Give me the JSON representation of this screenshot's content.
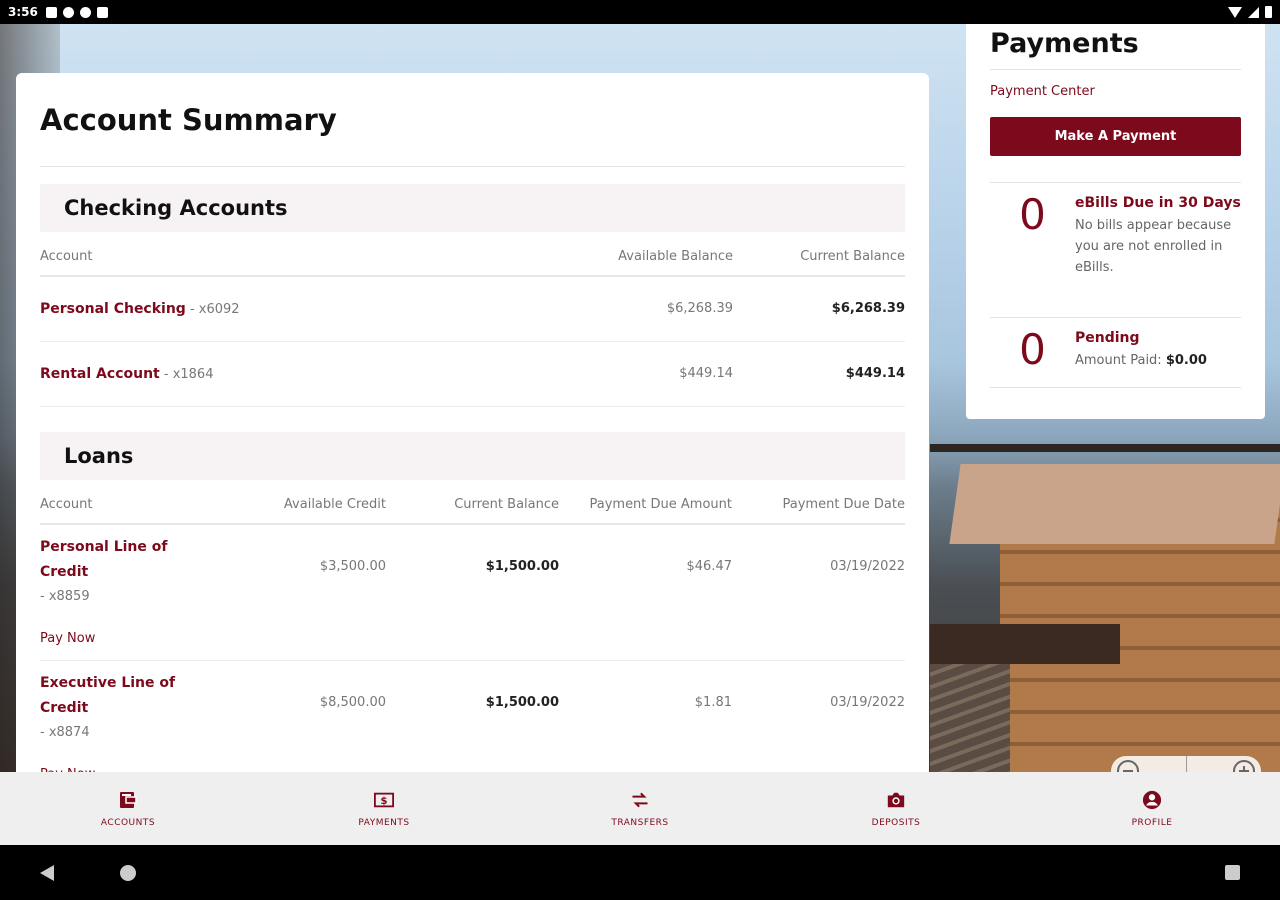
{
  "status": {
    "time": "3:56"
  },
  "main": {
    "title": "Account Summary",
    "checking": {
      "heading": "Checking Accounts",
      "columns": [
        "Account",
        "Available Balance",
        "Current Balance"
      ],
      "rows": [
        {
          "name": "Personal Checking",
          "suffix": " - x6092",
          "available": "$6,268.39",
          "current": "$6,268.39"
        },
        {
          "name": "Rental Account",
          "suffix": " - x1864",
          "available": "$449.14",
          "current": "$449.14"
        }
      ]
    },
    "loans": {
      "heading": "Loans",
      "columns": [
        "Account",
        "Available Credit",
        "Current Balance",
        "Payment Due Amount",
        "Payment Due Date"
      ],
      "rows": [
        {
          "name": "Personal Line of Credit",
          "mask": "- x8859",
          "available": "$3,500.00",
          "current": "$1,500.00",
          "due_amount": "$46.47",
          "due_date": "03/19/2022",
          "pay_now": "Pay Now"
        },
        {
          "name": "Executive Line of Credit",
          "mask": "- x8874",
          "available": "$8,500.00",
          "current": "$1,500.00",
          "due_amount": "$1.81",
          "due_date": "03/19/2022",
          "pay_now": "Pay Now"
        }
      ]
    }
  },
  "payments": {
    "title": "Payments",
    "center_link": "Payment Center",
    "button": "Make A Payment",
    "ebills": {
      "count": "0",
      "label": "eBills Due in 30 Days",
      "desc": "No bills appear because you are not enrolled in eBills."
    },
    "pending": {
      "count": "0",
      "label": "Pending",
      "amount_label": "Amount Paid:",
      "amount": "$0.00"
    }
  },
  "nav": {
    "items": [
      {
        "label": "ACCOUNTS",
        "icon": "wallet-icon"
      },
      {
        "label": "PAYMENTS",
        "icon": "dollar-bill-icon"
      },
      {
        "label": "TRANSFERS",
        "icon": "transfer-arrows-icon"
      },
      {
        "label": "DEPOSITS",
        "icon": "camera-icon"
      },
      {
        "label": "PROFILE",
        "icon": "user-circle-icon"
      }
    ]
  },
  "colors": {
    "brand": "#7d0a1c",
    "section_bg": "#f7f2f3",
    "nav_bg": "#efefef"
  }
}
